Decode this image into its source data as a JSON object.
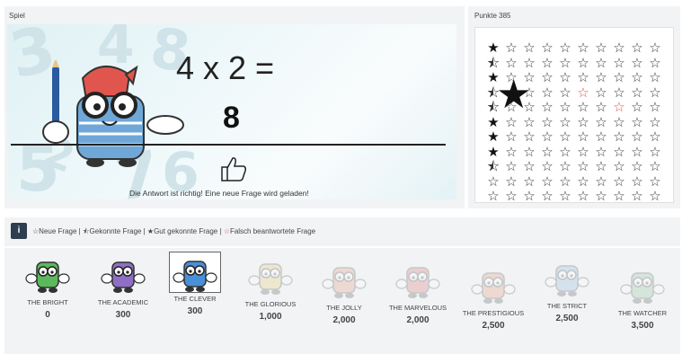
{
  "game": {
    "section_label": "Spiel",
    "question": "4 x 2 =",
    "answer": "8",
    "feedback": "Die Antwort ist richtig! Eine neue Frage wird geladen!"
  },
  "score": {
    "label": "Punkte 385"
  },
  "star_grid": {
    "rows": 11,
    "cols": 10,
    "first_column": [
      "solid",
      "half",
      "solid",
      "half",
      "half",
      "solid",
      "solid",
      "solid",
      "half",
      "empty",
      "empty"
    ],
    "wrong_cells": [
      [
        3,
        5
      ],
      [
        4,
        7
      ]
    ]
  },
  "legend": {
    "info_label": "i",
    "new_question": "Neue Frage |",
    "known_question": "Gekonnte Frage |",
    "well_known_question": "Gut gekonnte Frage |",
    "wrong_question": "Falsch beantwortete Frage"
  },
  "levels": [
    {
      "name": "THE BRIGHT",
      "points": "0",
      "state": "unlocked"
    },
    {
      "name": "THE ACADEMIC",
      "points": "300",
      "state": "unlocked"
    },
    {
      "name": "THE CLEVER",
      "points": "300",
      "state": "selected"
    },
    {
      "name": "THE GLORIOUS",
      "points": "1,000",
      "state": "locked"
    },
    {
      "name": "THE JOLLY",
      "points": "2,000",
      "state": "locked"
    },
    {
      "name": "THE MARVELOUS",
      "points": "2,000",
      "state": "locked"
    },
    {
      "name": "THE PRESTIGIOUS",
      "points": "2,500",
      "state": "locked"
    },
    {
      "name": "THE STRICT",
      "points": "2,500",
      "state": "locked"
    },
    {
      "name": "THE WATCHER",
      "points": "3,500",
      "state": "locked"
    }
  ],
  "icons": {
    "star_empty": "☆",
    "star_solid": "★",
    "star_half": "⯪",
    "info": "info-icon"
  }
}
